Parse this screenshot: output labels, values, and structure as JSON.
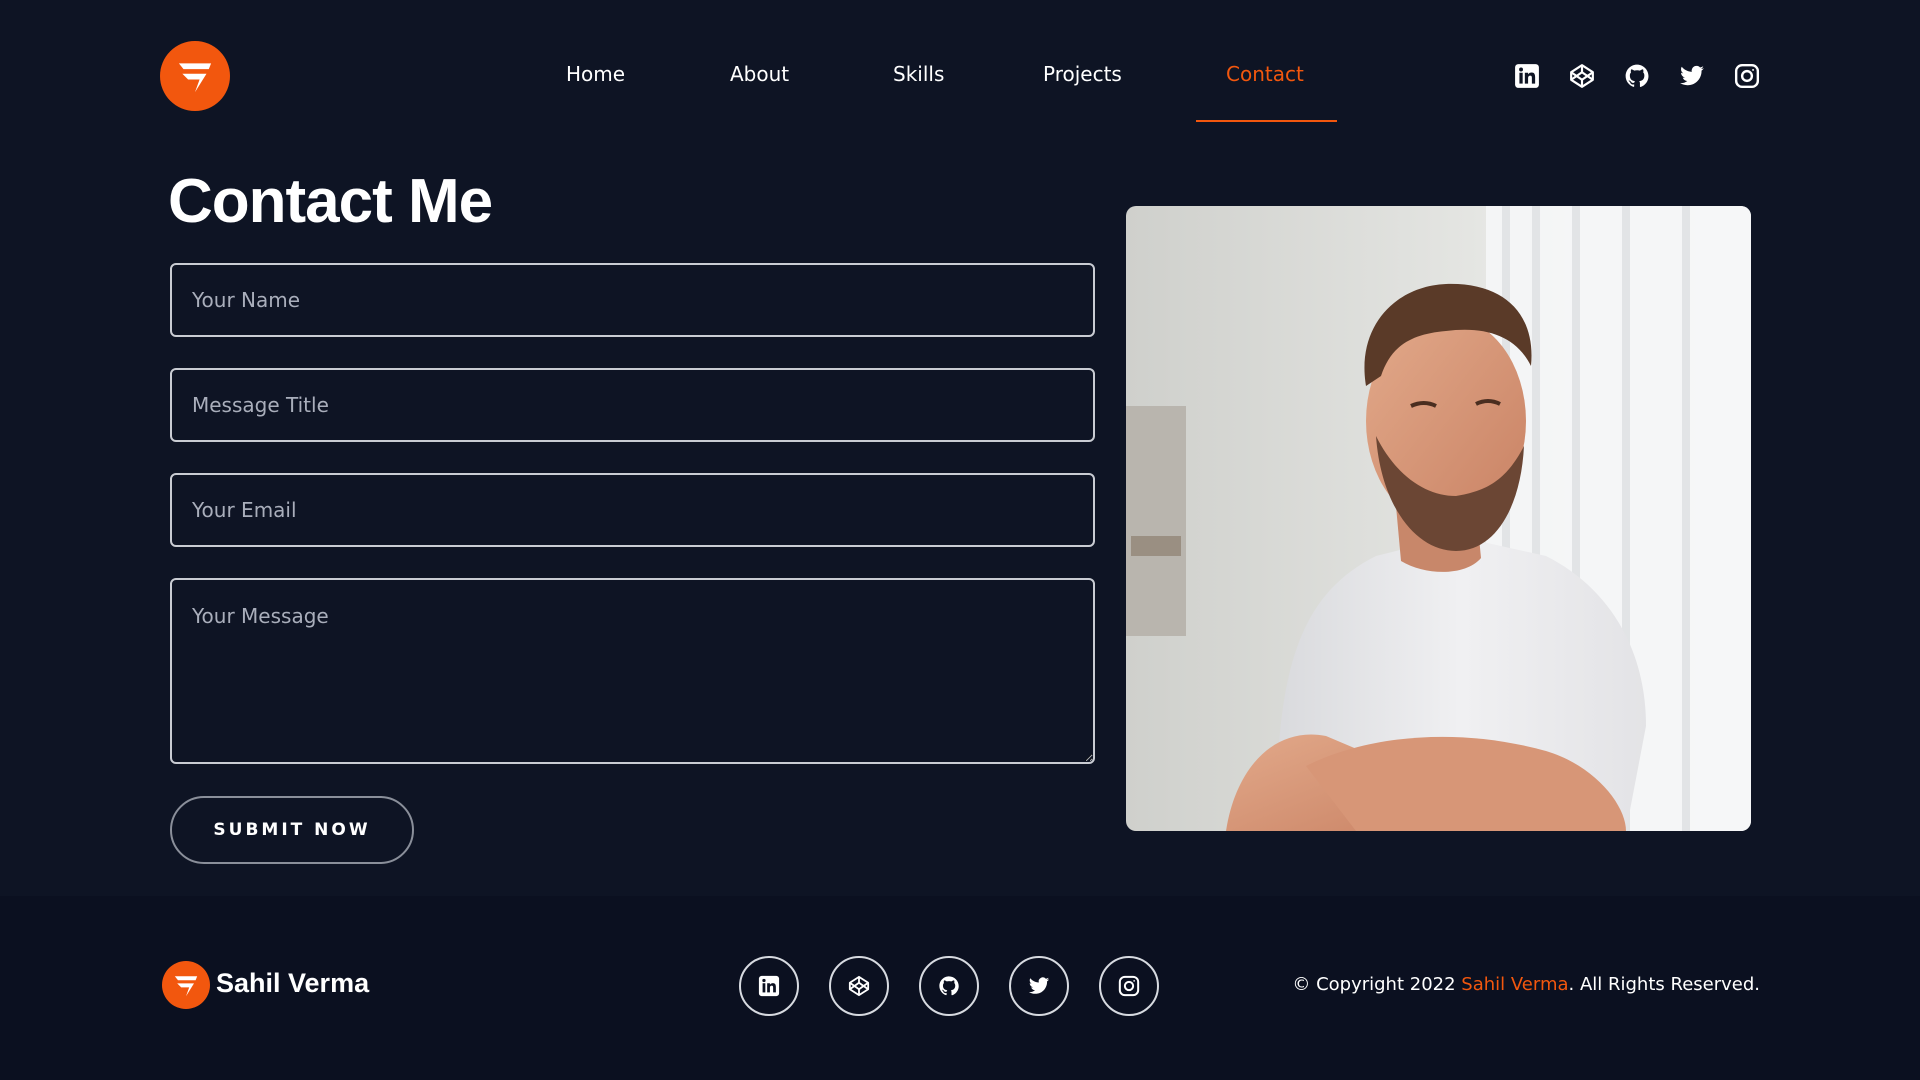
{
  "brand": {
    "name": "Sahil Verma",
    "accent_color": "#f2570e",
    "background_color": "#0e1424",
    "logo_icon": "brand-logo-icon"
  },
  "nav": {
    "items": [
      {
        "label": "Home",
        "active": false
      },
      {
        "label": "About",
        "active": false
      },
      {
        "label": "Skills",
        "active": false
      },
      {
        "label": "Projects",
        "active": false
      },
      {
        "label": "Contact",
        "active": true
      }
    ]
  },
  "social_icons": [
    "linkedin-icon",
    "codepen-icon",
    "github-icon",
    "twitter-icon",
    "instagram-icon"
  ],
  "contact": {
    "title": "Contact Me",
    "fields": {
      "name_placeholder": "Your Name",
      "title_placeholder": "Message Title",
      "email_placeholder": "Your Email",
      "message_placeholder": "Your Message"
    },
    "submit_label": "SUBMIT NOW"
  },
  "footer": {
    "name": "Sahil Verma",
    "copyright_prefix": "© Copyright 2022 ",
    "copyright_name": "Sahil Verma",
    "copyright_suffix": ". All Rights Reserved."
  }
}
